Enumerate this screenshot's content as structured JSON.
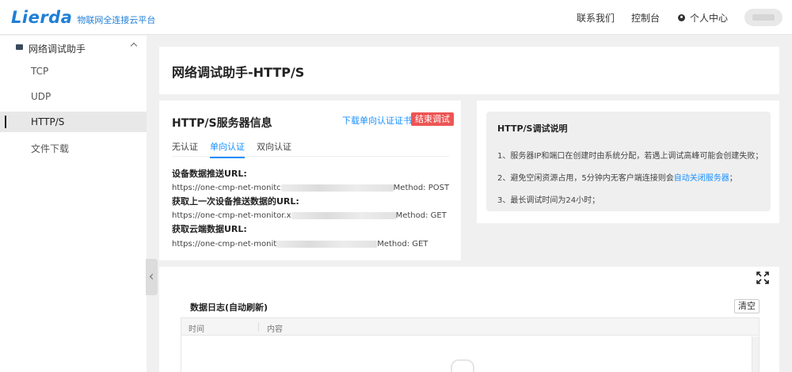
{
  "header": {
    "logo_text": "Lierda",
    "logo_subtitle": "物联网全连接云平台",
    "nav": {
      "contact": "联系我们",
      "console": "控制台",
      "user_center": "个人中心"
    }
  },
  "sidebar": {
    "group_label": "网络调试助手",
    "items": [
      {
        "label": "TCP"
      },
      {
        "label": "UDP"
      },
      {
        "label": "HTTP/S"
      },
      {
        "label": "文件下载"
      }
    ]
  },
  "page": {
    "title": "网络调试助手-HTTP/S"
  },
  "server_info": {
    "title": "HTTP/S服务器信息",
    "download_link": "下载单向认证证书",
    "end_button": "结束调试",
    "tabs": [
      {
        "label": "无认证"
      },
      {
        "label": "单向认证"
      },
      {
        "label": "双向认证"
      }
    ],
    "sections": [
      {
        "label": "设备数据推送URL:",
        "url_prefix": "https://one-cmp-net-monitc",
        "method": "Method: POST"
      },
      {
        "label": "获取上一次设备推送数据的URL:",
        "url_prefix": "https://one-cmp-net-monitor.x",
        "method": "Method: GET"
      },
      {
        "label": "获取云端数据URL:",
        "url_prefix": "https://one-cmp-net-monit",
        "method": "Method: GET"
      }
    ]
  },
  "description": {
    "title": "HTTP/S调试说明",
    "line1": "1、服务器IP和端口在创建时由系统分配，若遇上调试高峰可能会创建失败；",
    "line2_prefix": "2、避免空闲资源占用，5分钟内无客户端连接则会",
    "line2_link": "自动关闭服务器",
    "line2_suffix": "；",
    "line3": "3、最长调试时间为24小时；"
  },
  "log": {
    "title": "数据日志(自动刷新)",
    "clear_button": "清空",
    "columns": [
      "时间",
      "内容"
    ]
  },
  "colors": {
    "brand": "#1f7fd6",
    "link": "#1890ff",
    "danger": "#ee5555"
  }
}
